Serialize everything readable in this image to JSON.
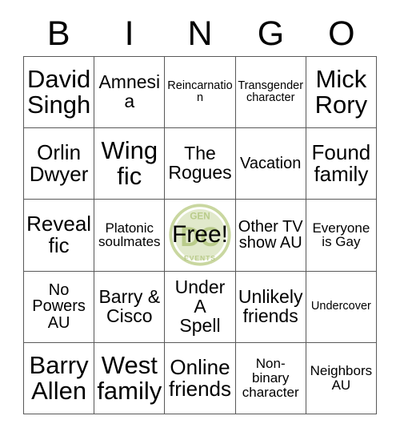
{
  "card": {
    "title": "BINGO",
    "headers": [
      "B",
      "I",
      "N",
      "G",
      "O"
    ],
    "free_space": {
      "label": "Free!",
      "logo": {
        "top_text": "GEN",
        "bottom_text": "EVENTS",
        "monogram": "DC",
        "color": "#c9d7a0",
        "accent_color": "#b9cb8a"
      }
    },
    "colors": {
      "background": "#ffffff",
      "grid_line": "#595959",
      "text": "#000000"
    },
    "rows": [
      [
        {
          "text": "David\nSingh",
          "size": "fs-xl"
        },
        {
          "text": "Amnesia",
          "size": "fs-md"
        },
        {
          "text": "Reincarnation",
          "size": "fs-xxs"
        },
        {
          "text": "Transgender\ncharacter",
          "size": "fs-xxs"
        },
        {
          "text": "Mick\nRory",
          "size": "fs-xl"
        }
      ],
      [
        {
          "text": "Orlin\nDwyer",
          "size": "fs-lg"
        },
        {
          "text": "Wing\nfic",
          "size": "fs-xl"
        },
        {
          "text": "The\nRogues",
          "size": "fs-md"
        },
        {
          "text": "Vacation",
          "size": "fs-sm"
        },
        {
          "text": "Found\nfamily",
          "size": "fs-lg"
        }
      ],
      [
        {
          "text": "Reveal\nfic",
          "size": "fs-lg"
        },
        {
          "text": "Platonic\nsoulmates",
          "size": "fs-xs"
        },
        {
          "text": "Free!",
          "size": "fs-xl",
          "free": true
        },
        {
          "text": "Other TV\nshow AU",
          "size": "fs-sm"
        },
        {
          "text": "Everyone\nis Gay",
          "size": "fs-xs"
        }
      ],
      [
        {
          "text": "No\nPowers\nAU",
          "size": "fs-sm"
        },
        {
          "text": "Barry &\nCisco",
          "size": "fs-md"
        },
        {
          "text": "Under\nA\nSpell",
          "size": "fs-md"
        },
        {
          "text": "Unlikely\nfriends",
          "size": "fs-md"
        },
        {
          "text": "Undercover",
          "size": "fs-xxs"
        }
      ],
      [
        {
          "text": "Barry\nAllen",
          "size": "fs-xl"
        },
        {
          "text": "West\nfamily",
          "size": "fs-xl"
        },
        {
          "text": "Online\nfriends",
          "size": "fs-lg"
        },
        {
          "text": "Non-\nbinary\ncharacter",
          "size": "fs-xs"
        },
        {
          "text": "Neighbors\nAU",
          "size": "fs-xs"
        }
      ]
    ]
  }
}
